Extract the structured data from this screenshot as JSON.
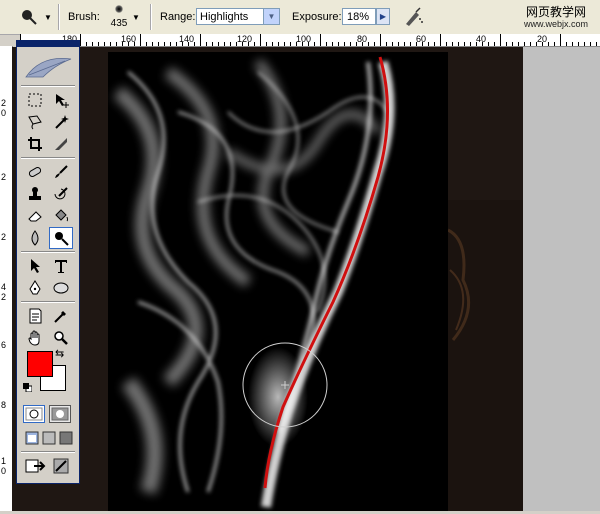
{
  "options": {
    "brush_label": "Brush:",
    "brush_size": "435",
    "range_label": "Range:",
    "range_value": "Highlights",
    "exposure_label": "Exposure:",
    "exposure_value": "18%"
  },
  "watermark": {
    "line1": "网页教学网",
    "line2": "www.webjx.com"
  },
  "ruler": {
    "labels": [
      "180",
      "160",
      "140",
      "120",
      "100",
      "80",
      "60",
      "40",
      "20"
    ]
  },
  "vruler": {
    "labels": [
      "2",
      "0",
      "2",
      "2",
      "4",
      "2",
      "6",
      "8",
      "1",
      "0"
    ]
  },
  "colors": {
    "foreground": "#ff0000",
    "background": "#ffffff",
    "accent": "#0a246a",
    "stroke": "#d01010"
  },
  "icons": [
    "tool-preset-icon",
    "airbrush-icon",
    "marquee-icon",
    "move-icon",
    "lasso-icon",
    "magic-wand-icon",
    "crop-icon",
    "slice-icon",
    "healing-icon",
    "brush-icon",
    "stamp-icon",
    "history-brush-icon",
    "eraser-icon",
    "bucket-icon",
    "blur-icon",
    "dodge-icon",
    "path-select-icon",
    "type-icon",
    "pen-icon",
    "ellipse-icon",
    "notes-icon",
    "eyedropper-icon",
    "hand-icon",
    "zoom-icon"
  ]
}
